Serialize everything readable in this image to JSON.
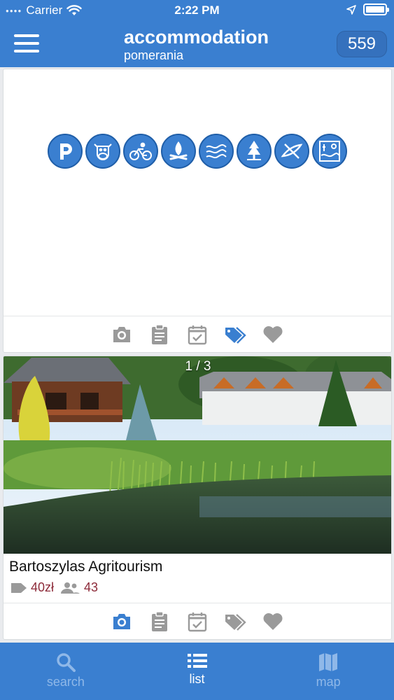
{
  "status_bar": {
    "carrier": "Carrier",
    "time": "2:22 PM"
  },
  "header": {
    "title": "accommodation",
    "subtitle": "pomerania",
    "count": "559"
  },
  "colors": {
    "brand_blue": "#3a7fd0",
    "active_action": "#3a7fd0",
    "inactive_action": "#9a9a9a",
    "price_color": "#8d2b3a"
  },
  "card1": {
    "amenities": [
      "parking-icon",
      "cow-icon",
      "cycling-icon",
      "campfire-icon",
      "river-icon",
      "forest-icon",
      "kayak-icon",
      "lake-view-icon"
    ],
    "actions": [
      {
        "name": "photos-icon",
        "active": false
      },
      {
        "name": "details-icon",
        "active": false
      },
      {
        "name": "calendar-icon",
        "active": false
      },
      {
        "name": "tags-icon",
        "active": true
      },
      {
        "name": "favorite-icon",
        "active": false
      }
    ]
  },
  "card2": {
    "photo_counter": "1 / 3",
    "name": "Bartoszylas Agritourism",
    "price": "40zł",
    "capacity": "43",
    "actions": [
      {
        "name": "photos-icon",
        "active": true
      },
      {
        "name": "details-icon",
        "active": false
      },
      {
        "name": "calendar-icon",
        "active": false
      },
      {
        "name": "tags-icon",
        "active": false
      },
      {
        "name": "favorite-icon",
        "active": false
      }
    ]
  },
  "tabs": [
    {
      "label": "search",
      "icon": "search-icon",
      "active": false
    },
    {
      "label": "list",
      "icon": "list-icon",
      "active": true
    },
    {
      "label": "map",
      "icon": "map-icon",
      "active": false
    }
  ]
}
